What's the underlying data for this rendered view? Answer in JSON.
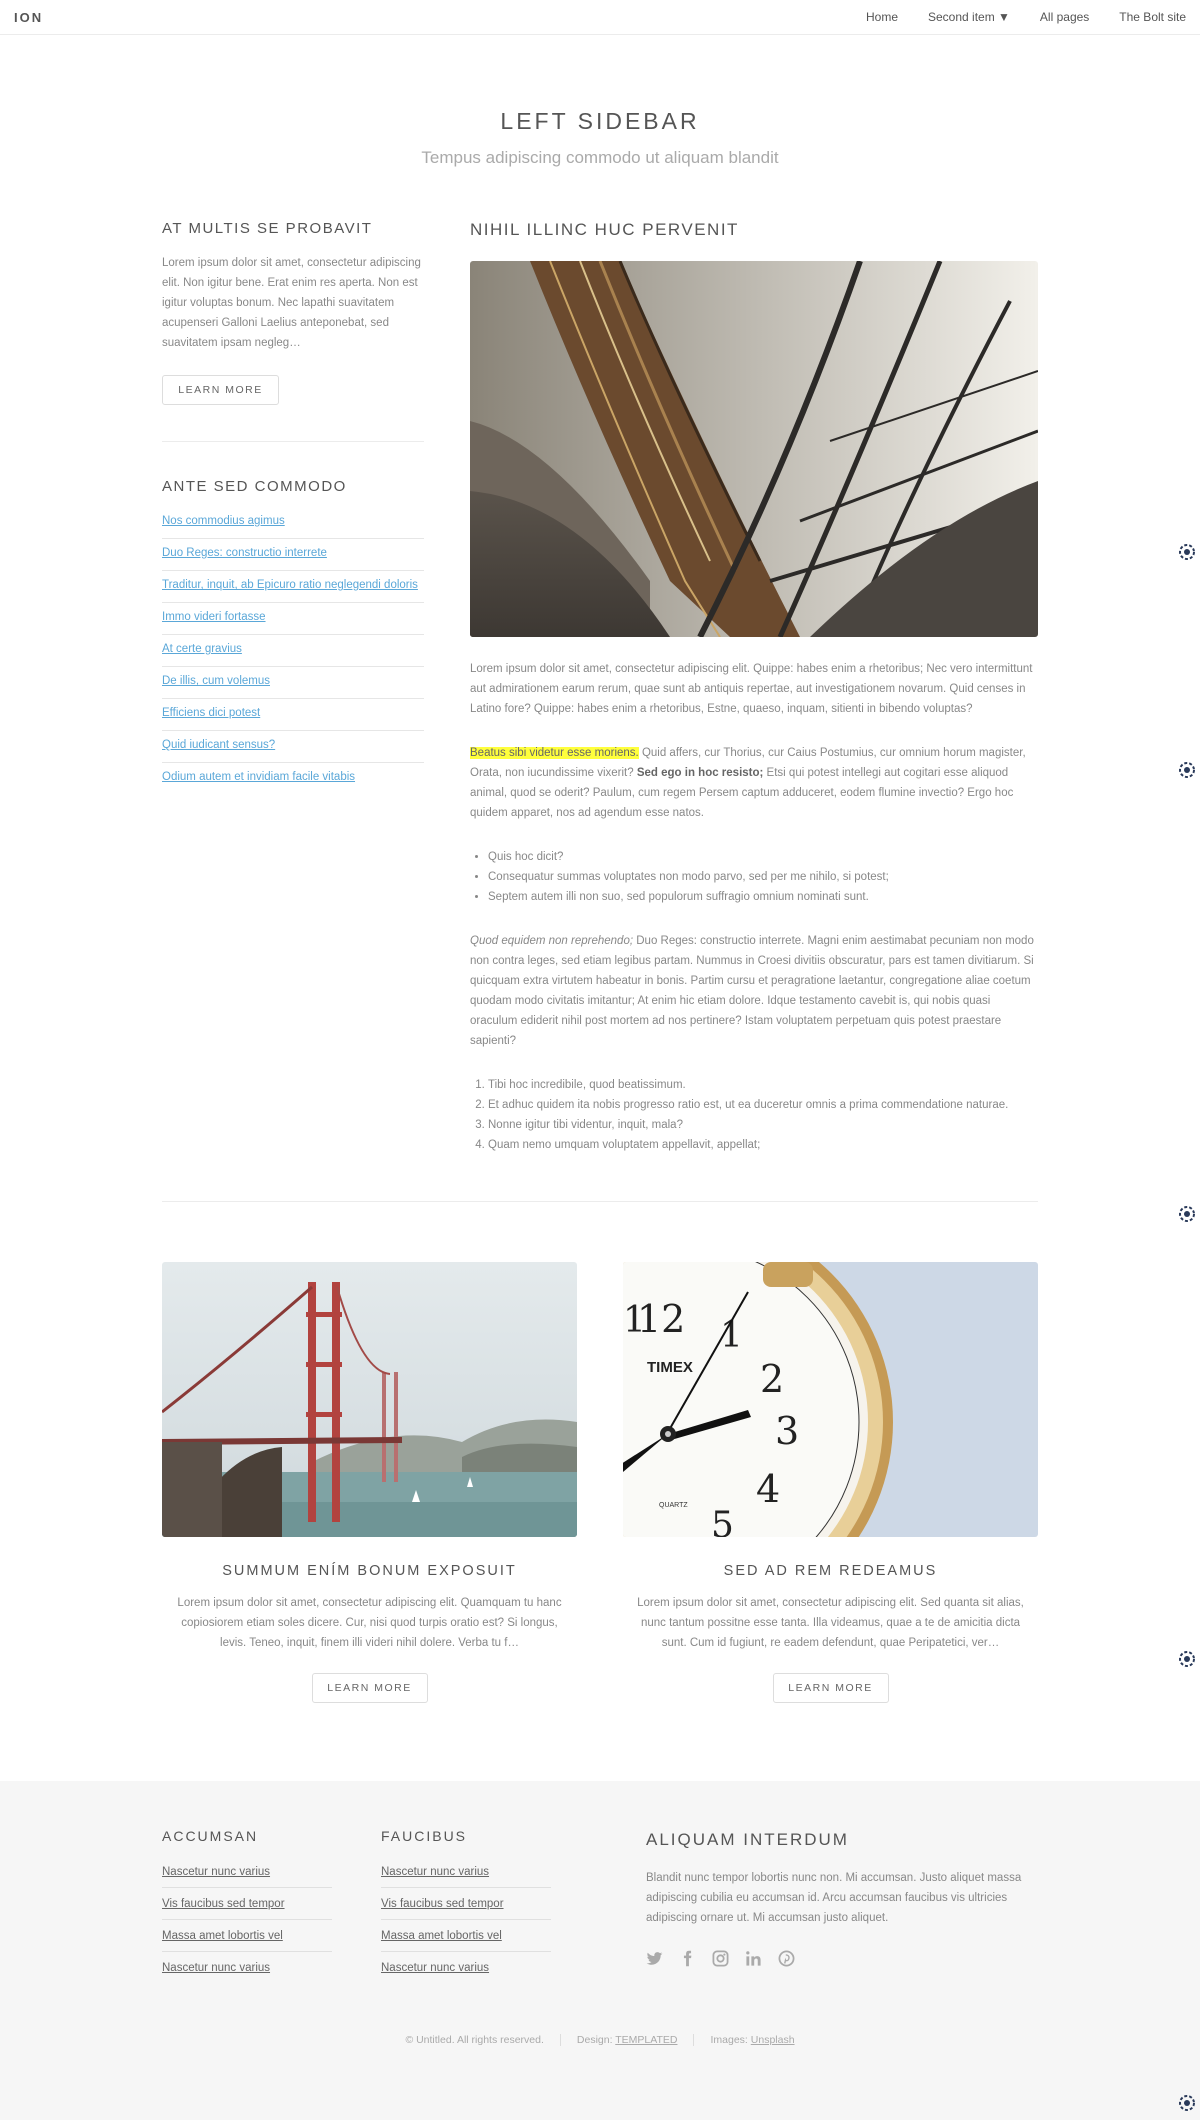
{
  "header": {
    "logo": "ION",
    "nav": [
      "Home",
      "Second item ▼",
      "All pages",
      "The Bolt site"
    ]
  },
  "page": {
    "title": "LEFT SIDEBAR",
    "subtitle": "Tempus adipiscing commodo ut aliquam blandit"
  },
  "sidebar": {
    "heading1": "AT MULTIS SE PROBAVIT",
    "text": "Lorem ipsum dolor sit amet, consectetur adipiscing elit. Non igitur bene. Erat enim res aperta. Non est igitur voluptas bonum. Nec lapathi suavitatem acupenseri Galloni Laelius anteponebat, sed suavitatem ipsam negleg…",
    "button": "LEARN MORE",
    "heading2": "ANTE SED COMMODO",
    "links": [
      "Nos commodius agimus",
      "Duo Reges: constructio interrete",
      "Traditur, inquit, ab Epicuro ratio neglegendi doloris",
      "Immo videri fortasse",
      "At certe gravius",
      "De illis, cum volemus",
      "Efficiens dici potest",
      "Quid iudicant sensus?",
      "Odium autem et invidiam facile vitabis"
    ]
  },
  "main": {
    "heading": "NIHIL ILLINC HUC PERVENIT",
    "p1": "Lorem ipsum dolor sit amet, consectetur adipiscing elit. Quippe: habes enim a rhetoribus; Nec vero intermittunt aut admirationem earum rerum, quae sunt ab antiquis repertae, aut investigationem novarum. Quid censes in Latino fore? Quippe: habes enim a rhetoribus, Estne, quaeso, inquam, sitienti in bibendo voluptas?",
    "p2_highlight": "Beatus sibi videtur esse moriens.",
    "p2_a": " Quid affers, cur Thorius, cur Caius Postumius, cur omnium horum magister, Orata, non iucundissime vixerit? ",
    "p2_bold": "Sed ego in hoc resisto;",
    "p2_b": " Etsi qui potest intellegi aut cogitari esse aliquod animal, quod se oderit? Paulum, cum regem Persem captum adduceret, eodem flumine invectio? Ergo hoc quidem apparet, nos ad agendum esse natos.",
    "bullets": [
      "Quis hoc dicit?",
      "Consequatur summas voluptates non modo parvo, sed per me nihilo, si potest;",
      "Septem autem illi non suo, sed populorum suffragio omnium nominati sunt."
    ],
    "p3_em": "Quod equidem non reprehendo;",
    "p3": " Duo Reges: constructio interrete. Magni enim aestimabat pecuniam non modo non contra leges, sed etiam legibus partam. Nummus in Croesi divitiis obscuratur, pars est tamen divitiarum. Si quicquam extra virtutem habeatur in bonis. Partim cursu et peragratione laetantur, congregatione aliae coetum quodam modo civitatis imitantur; At enim hic etiam dolore. Idque testamento cavebit is, qui nobis quasi oraculum ediderit nihil post mortem ad nos pertinere? Istam voluptatem perpetuam quis potest praestare sapienti?",
    "ordered": [
      "Tibi hoc incredibile, quod beatissimum.",
      "Et adhuc quidem ita nobis progresso ratio est, ut ea duceretur omnis a prima commendatione naturae.",
      "Nonne igitur tibi videntur, inquit, mala?",
      "Quam nemo umquam voluptatem appellavit, appellat;"
    ]
  },
  "cards": [
    {
      "title": "SUMMUM ENÍM BONUM EXPOSUIT",
      "text": "Lorem ipsum dolor sit amet, consectetur adipiscing elit. Quamquam tu hanc copiosiorem etiam soles dicere. Cur, nisi quod turpis oratio est? Si longus, levis. Teneo, inquit, finem illi videri nihil dolere. Verba tu f…",
      "button": "LEARN MORE"
    },
    {
      "title": "SED AD REM REDEAMUS",
      "text": "Lorem ipsum dolor sit amet, consectetur adipiscing elit. Sed quanta sit alias, nunc tantum possitne esse tanta. Illa videamus, quae a te de amicitia dicta sunt. Cum id fugiunt, re eadem defendunt, quae Peripatetici, ver…",
      "button": "LEARN MORE",
      "clock_brand": "TIMEX",
      "clock_sub": "QUARTZ"
    }
  ],
  "footer": {
    "col1": {
      "heading": "ACCUMSAN",
      "links": [
        "Nascetur nunc varius",
        "Vis faucibus sed tempor",
        "Massa amet lobortis vel",
        "Nascetur nunc varius"
      ]
    },
    "col2": {
      "heading": "FAUCIBUS",
      "links": [
        "Nascetur nunc varius",
        "Vis faucibus sed tempor",
        "Massa amet lobortis vel",
        "Nascetur nunc varius"
      ]
    },
    "about": {
      "heading": "ALIQUAM INTERDUM",
      "text": "Blandit nunc tempor lobortis nunc non. Mi accumsan. Justo aliquet massa adipiscing cubilia eu accumsan id. Arcu accumsan faucibus vis ultricies adipiscing ornare ut. Mi accumsan justo aliquet."
    },
    "social_icons": [
      "twitter-icon",
      "facebook-icon",
      "instagram-icon",
      "linkedin-icon",
      "pinterest-icon"
    ],
    "copyright": "© Untitled. All rights reserved.",
    "design_label": "Design:",
    "design_link": "TEMPLATED",
    "images_label": "Images:",
    "images_link": "Unsplash"
  },
  "colors": {
    "link": "#5aa7d8",
    "highlight": "#ffff3c",
    "footer_bg": "#f6f6f6"
  }
}
